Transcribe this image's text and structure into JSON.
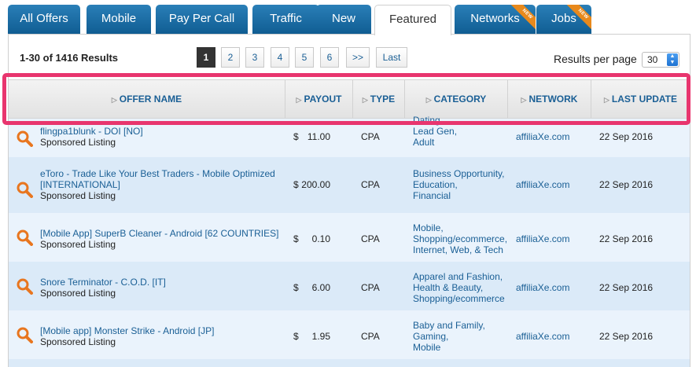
{
  "tabs": [
    {
      "label": "All Offers",
      "badge": ""
    },
    {
      "label": "Mobile",
      "badge": ""
    },
    {
      "label": "Pay Per Call",
      "badge": ""
    },
    {
      "label": "Traffic",
      "badge": ""
    },
    {
      "label": "New",
      "badge": ""
    },
    {
      "label": "Featured",
      "badge": ""
    },
    {
      "label": "Networks",
      "badge": "NEW"
    },
    {
      "label": "Jobs",
      "badge": "NEW"
    }
  ],
  "results_summary": "1-30 of 1416 Results",
  "pager": [
    "1",
    "2",
    "3",
    "4",
    "5",
    "6",
    ">>",
    "Last"
  ],
  "results_per_page": {
    "label": "Results per page",
    "value": "30"
  },
  "columns": [
    "OFFER NAME",
    "PAYOUT",
    "TYPE",
    "CATEGORY",
    "NETWORK",
    "LAST UPDATE"
  ],
  "rows": [
    {
      "name": [
        "flingpa1blunk - DOI [NO]"
      ],
      "sponsored": "Sponsored Listing",
      "payout_currency": "$",
      "payout_amount": "11.00",
      "type": "CPA",
      "category": [
        "Dating,",
        "Lead Gen,",
        "Adult"
      ],
      "network": "affiliaXe.com",
      "updated": "22 Sep 2016"
    },
    {
      "name": [
        "eToro - Trade Like Your Best Traders - Mobile Optimized",
        "[INTERNATIONAL]"
      ],
      "sponsored": "Sponsored Listing",
      "payout_currency": "$",
      "payout_amount": "200.00",
      "type": "CPA",
      "category": [
        "Business Opportunity,",
        "Education,",
        "Financial"
      ],
      "network": "affiliaXe.com",
      "updated": "22 Sep 2016"
    },
    {
      "name": [
        "[Mobile App] SuperB Cleaner - Android [62 COUNTRIES]"
      ],
      "sponsored": "Sponsored Listing",
      "payout_currency": "$",
      "payout_amount": "0.10",
      "type": "CPA",
      "category": [
        "Mobile,",
        "Shopping/ecommerce,",
        "Internet, Web, & Tech"
      ],
      "network": "affiliaXe.com",
      "updated": "22 Sep 2016"
    },
    {
      "name": [
        "Snore Terminator - C.O.D. [IT]"
      ],
      "sponsored": "Sponsored Listing",
      "payout_currency": "$",
      "payout_amount": "6.00",
      "type": "CPA",
      "category": [
        "Apparel and Fashion,",
        "Health & Beauty,",
        "Shopping/ecommerce"
      ],
      "network": "affiliaXe.com",
      "updated": "22 Sep 2016"
    },
    {
      "name": [
        "[Mobile app] Monster Strike - Android [JP]"
      ],
      "sponsored": "Sponsored Listing",
      "payout_currency": "$",
      "payout_amount": "1.95",
      "type": "CPA",
      "category": [
        "Baby and Family,",
        "Gaming,",
        "Mobile"
      ],
      "network": "affiliaXe.com",
      "updated": "22 Sep 2016"
    }
  ],
  "colors": {
    "accent": "#1a5f95",
    "tab": "#0f5c91",
    "highlight": "#e8356e",
    "row_alt": "#dbeaf8",
    "row_base": "#eaf3fc",
    "icon": "#e8761f"
  }
}
